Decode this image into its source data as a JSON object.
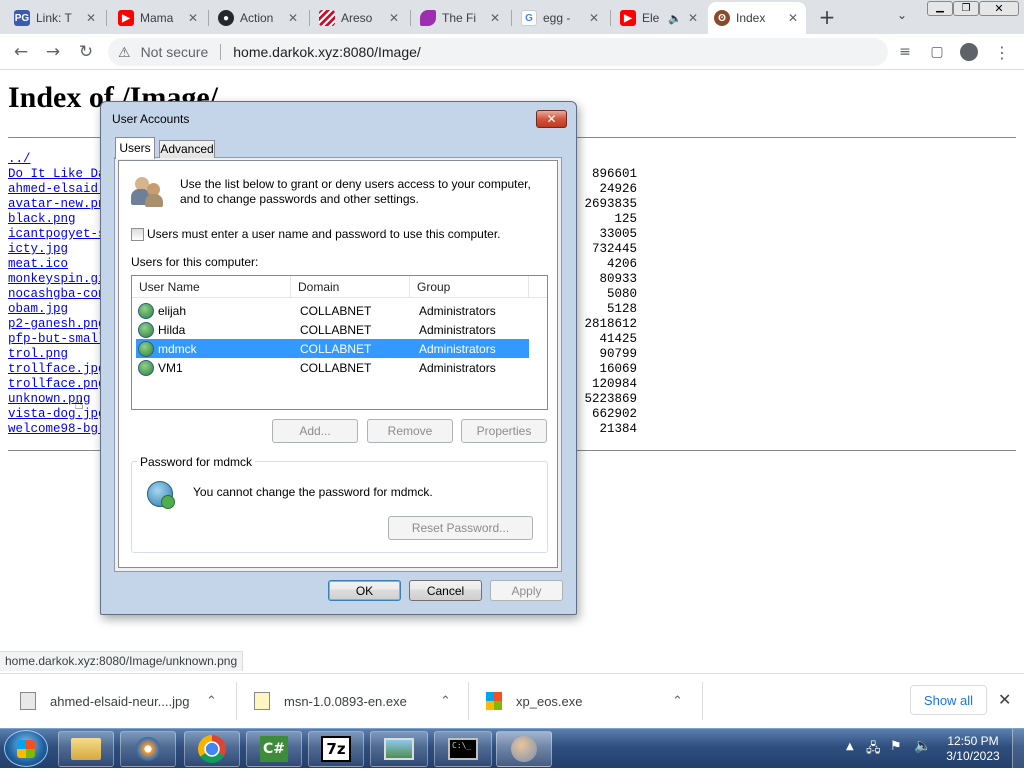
{
  "browser": {
    "tabs": [
      {
        "title": "Link: T",
        "favicon": "pg-icon",
        "color": "#3b5bb0"
      },
      {
        "title": "Mama",
        "favicon": "youtube-icon",
        "color": "#ff0000"
      },
      {
        "title": "Action",
        "favicon": "github-icon",
        "color": "#24292f"
      },
      {
        "title": "Areso",
        "favicon": "ares-icon",
        "color": "#c8102e"
      },
      {
        "title": "The Fi",
        "favicon": "fish-icon",
        "color": "#9b2fae"
      },
      {
        "title": "egg -",
        "favicon": "google-icon",
        "color": "#4285f4"
      },
      {
        "title": "Ele",
        "favicon": "youtube-icon",
        "color": "#ff0000"
      },
      {
        "title": "Index",
        "favicon": "bear-icon",
        "color": "#8b4a2b"
      }
    ],
    "security_label": "Not secure",
    "url": "home.darkok.xyz:8080/Image/",
    "status_url": "home.darkok.xyz:8080/Image/unknown.png"
  },
  "page": {
    "heading": "Index of /Image/",
    "parent_link": "../",
    "files": [
      {
        "name": "Do It Like Da",
        "size": "896601"
      },
      {
        "name": "ahmed-elsaid-",
        "size": "24926"
      },
      {
        "name": "avatar-new.pn",
        "size": "2693835"
      },
      {
        "name": "black.png",
        "size": "125"
      },
      {
        "name": "icantpogyet-s",
        "size": "33005"
      },
      {
        "name": "icty.jpg",
        "size": "732445"
      },
      {
        "name": "meat.ico",
        "size": "4206"
      },
      {
        "name": "monkeyspin.gi",
        "size": "80933"
      },
      {
        "name": "nocashgba-con",
        "size": "5080"
      },
      {
        "name": "obam.jpg",
        "size": "5128"
      },
      {
        "name": "p2-ganesh.png",
        "size": "2818612"
      },
      {
        "name": "pfp-but-small",
        "size": "41425"
      },
      {
        "name": "trol.png",
        "size": "90799"
      },
      {
        "name": "trollface.jpg",
        "size": "16069"
      },
      {
        "name": "trollface.png",
        "size": "120984"
      },
      {
        "name": "unknown.png",
        "size": "5223869"
      },
      {
        "name": "vista-dog.jpg",
        "size": "662902"
      },
      {
        "name": "welcome98-bg.",
        "size": "21384"
      }
    ]
  },
  "dialog": {
    "title": "User Accounts",
    "tabs": [
      "Users",
      "Advanced"
    ],
    "active_tab": "Users",
    "intro": "Use the list below to grant or deny users access to your computer, and to change passwords and other settings.",
    "checkbox_label": "Users must enter a user name and password to use this computer.",
    "checkbox_checked": false,
    "list_label": "Users for this computer:",
    "columns": [
      "User Name",
      "Domain",
      "Group"
    ],
    "users": [
      {
        "name": "elijah",
        "domain": "COLLABNET",
        "group": "Administrators"
      },
      {
        "name": "Hilda",
        "domain": "COLLABNET",
        "group": "Administrators"
      },
      {
        "name": "mdmck",
        "domain": "COLLABNET",
        "group": "Administrators",
        "selected": true
      },
      {
        "name": "VM1",
        "domain": "COLLABNET",
        "group": "Administrators"
      }
    ],
    "buttons": {
      "add": "Add...",
      "remove": "Remove",
      "properties": "Properties"
    },
    "password_group_title": "Password for mdmck",
    "password_message": "You cannot change the password for mdmck.",
    "reset_password": "Reset Password...",
    "ok": "OK",
    "cancel": "Cancel",
    "apply": "Apply"
  },
  "downloads": {
    "items": [
      {
        "name": "ahmed-elsaid-neur....jpg"
      },
      {
        "name": "msn-1.0.0893-en.exe"
      },
      {
        "name": "xp_eos.exe"
      }
    ],
    "show_all": "Show all"
  },
  "taskbar": {
    "apps": [
      "explorer-icon",
      "media-player-icon",
      "chrome-icon",
      "csharp-icon",
      "7zip-icon",
      "photo-viewer-icon",
      "cmd-icon",
      "user-accounts-icon"
    ],
    "time": "12:50 PM",
    "date": "3/10/2023"
  }
}
